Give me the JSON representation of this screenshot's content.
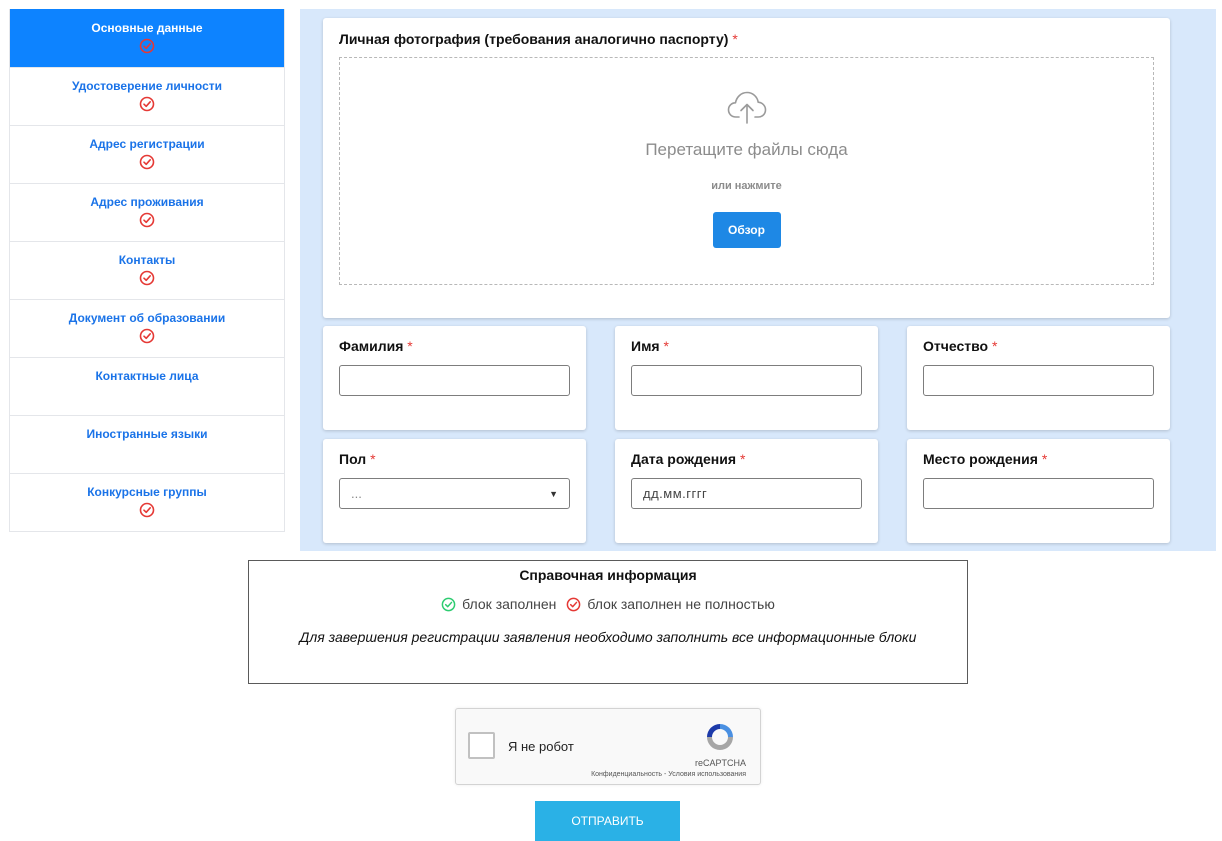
{
  "colors": {
    "active": "#0d83ff",
    "link": "#1a73e8",
    "panel_bg": "#d8e8fb",
    "incomplete": "#e53935",
    "complete": "#2ecc71",
    "primary_button": "#1e88e5",
    "submit_button": "#2ab1e6"
  },
  "sidebar": {
    "items": [
      {
        "label": "Основные данные",
        "status_icon": "check-circle-icon"
      },
      {
        "label": "Удостоверение личности",
        "status_icon": "check-circle-icon"
      },
      {
        "label": "Адрес регистрации",
        "status_icon": "check-circle-icon"
      },
      {
        "label": "Адрес проживания",
        "status_icon": "check-circle-icon"
      },
      {
        "label": "Контакты",
        "status_icon": "check-circle-icon"
      },
      {
        "label": "Документ об образовании",
        "status_icon": "check-circle-icon"
      },
      {
        "label": "Контактные лица"
      },
      {
        "label": "Иностранные языки"
      },
      {
        "label": "Конкурсные группы",
        "status_icon": "check-circle-icon"
      }
    ]
  },
  "photo": {
    "label": "Личная фотография (требования аналогично паспорту)",
    "required_mark": "*",
    "drop_text": "Перетащите файлы сюда",
    "or_text": "или нажмите",
    "browse_label": "Обзор"
  },
  "fields": {
    "lastname": {
      "label": "Фамилия",
      "required_mark": "*",
      "value": ""
    },
    "firstname": {
      "label": "Имя",
      "required_mark": "*",
      "value": ""
    },
    "middlename": {
      "label": "Отчество",
      "required_mark": "*",
      "value": ""
    },
    "gender": {
      "label": "Пол",
      "required_mark": "*",
      "value": "..."
    },
    "birthdate": {
      "label": "Дата рождения",
      "required_mark": "*",
      "placeholder": "дд.мм.гггг"
    },
    "birthplace": {
      "label": "Место рождения",
      "required_mark": "*",
      "value": ""
    }
  },
  "info": {
    "title": "Справочная информация",
    "legend_complete": "блок заполнен",
    "legend_incomplete": "блок заполнен не полностью",
    "note": "Для завершения регистрации заявления необходимо заполнить все информационные блоки"
  },
  "captcha": {
    "label": "Я не робот",
    "brand": "reCAPTCHA",
    "links": "Конфиденциальность - Условия использования"
  },
  "submit_label": "ОТПРАВИТЬ"
}
